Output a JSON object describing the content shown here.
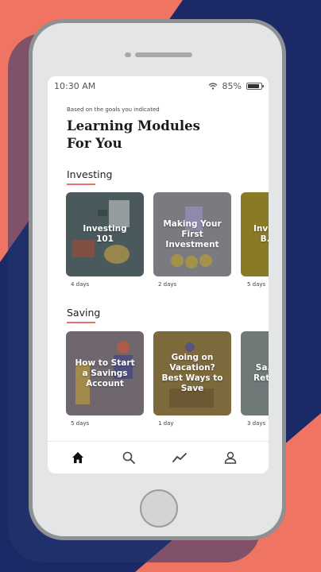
{
  "status_bar": {
    "time": "10:30 AM",
    "battery": "85%",
    "battery_level": 0.85
  },
  "header": {
    "subtitle": "Based on the goals you indicated",
    "title_line1": "Learning Modules",
    "title_line2": "For You"
  },
  "sections": [
    {
      "title": "Investing",
      "cards": [
        {
          "label": "Investing 101",
          "days": "4 days",
          "color": "#4a5a5c"
        },
        {
          "label": "Making Your First Investment",
          "days": "2 days",
          "color": "#7b7a80"
        },
        {
          "label": "Inve... B...",
          "days": "5 days",
          "color": "#8a7a25"
        }
      ]
    },
    {
      "title": "Saving",
      "cards": [
        {
          "label": "How to Start a Savings Account",
          "days": "5 days",
          "color": "#6f676d"
        },
        {
          "label": "Going on Vacation? Best Ways to Save",
          "days": "1 day",
          "color": "#7d6a3c"
        },
        {
          "label": "Sa... Ret...",
          "days": "3 days",
          "color": "#6e7978"
        }
      ]
    }
  ],
  "bottom_nav": [
    {
      "name": "home-icon",
      "active": true
    },
    {
      "name": "search-icon",
      "active": false
    },
    {
      "name": "trend-icon",
      "active": false
    },
    {
      "name": "profile-icon",
      "active": false
    }
  ],
  "colors": {
    "accent": "#e8726a",
    "background_navy": "#1b2a66",
    "background_coral": "#ef7462"
  }
}
